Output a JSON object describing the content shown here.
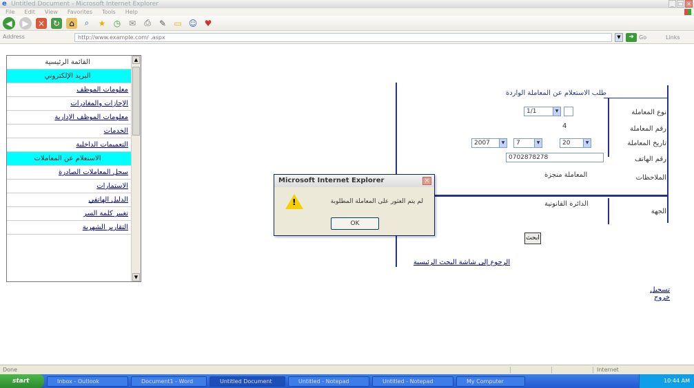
{
  "window": {
    "title": "Untitled Document - Microsoft Internet Explorer",
    "menu": [
      "File",
      "Edit",
      "View",
      "Favorites",
      "Tools",
      "Help"
    ]
  },
  "toolbar": {
    "back": "Back",
    "search": "Search",
    "favorites": "Favorites"
  },
  "addressbar": {
    "label": "Address",
    "value": "http://www.example.com/   .aspx",
    "go": "Go",
    "links": "Links"
  },
  "sidebar": {
    "items": [
      {
        "label": "القائمة الرئيسية",
        "style": "header"
      },
      {
        "label": "البريد الإلكتروني",
        "style": "cyan"
      },
      {
        "label": "معلومات الموظف",
        "style": "link"
      },
      {
        "label": "الإجازات والمغادرات",
        "style": "link"
      },
      {
        "label": "معلومات الموظف الإدارية",
        "style": "link"
      },
      {
        "label": "الخدمات",
        "style": "link"
      },
      {
        "label": "التعميمات الداخلية",
        "style": "link"
      },
      {
        "label": "الاستعلام عن المعاملات",
        "style": "cyan"
      },
      {
        "label": "سجل المعاملات الصادرة",
        "style": "link"
      },
      {
        "label": "الاستمارات",
        "style": "link"
      },
      {
        "label": "الدليل الهاتفي",
        "style": "link"
      },
      {
        "label": "تغيير كلمة السر",
        "style": "link"
      },
      {
        "label": "التقارير الشهرية",
        "style": "link"
      }
    ]
  },
  "form": {
    "title": "طلب الاستعلام عن المعاملة الواردة",
    "labels": {
      "type": "نوع المعاملة",
      "number": "رقم المعاملة",
      "date": "تاريخ المعاملة",
      "phone": "رقم الهاتف",
      "notes": "الملاحظات",
      "dept": "الجهة"
    },
    "type_select": "1/1",
    "number_value": "4",
    "date_year": "2007",
    "date_month": "7",
    "date_day": "20",
    "phone_value": "0702878278",
    "notes_value": "المعاملة منجزة",
    "dept_value": "الدائرة القانونية",
    "submit": "ابحث",
    "return_link": "الرجوع إلى شاشة البحث الرئيسية",
    "logout_link": "تسجيل خروج"
  },
  "dialog": {
    "title": "Microsoft Internet Explorer",
    "message": "لم يتم العثور على المعاملة المطلوبة",
    "ok": "OK"
  },
  "statusbar": {
    "left": "Done",
    "zone": "Internet"
  },
  "taskbar": {
    "start": "start",
    "tasks": [
      "Inbox - Outlook",
      "Document1 - Word",
      "Untitled Document",
      "Untitled - Notepad",
      "Untitled - Notepad",
      "My Computer"
    ],
    "clock": "10:44 AM"
  }
}
